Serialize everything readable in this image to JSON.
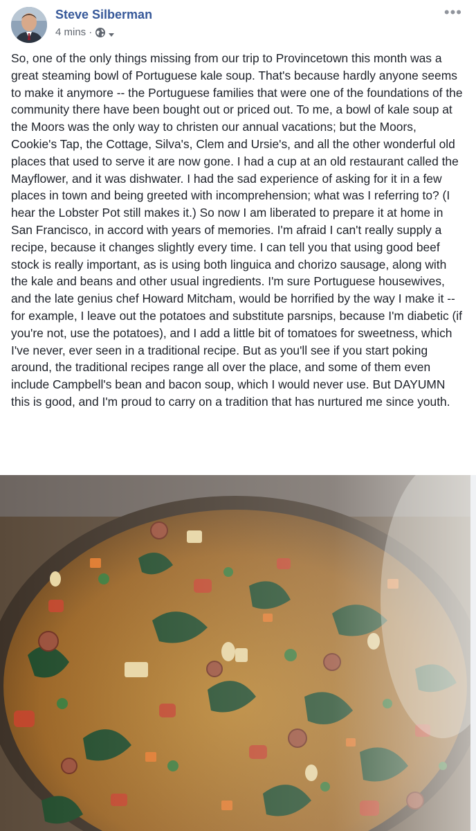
{
  "post": {
    "author": "Steve Silberman",
    "time": "4 mins",
    "privacy_icon": "globe-icon",
    "menu_icon": "more-options-icon",
    "more_label": "•••",
    "text": "So, one of the only things missing from our trip to Provincetown this month was a great steaming bowl of Portuguese kale soup. That's because hardly anyone seems to make it anymore -- the Portuguese families that were one of the foundations of the community there have been bought out or priced out. To me, a bowl of kale soup at the Moors was the only way to christen our annual vacations; but the Moors, Cookie's Tap, the Cottage, Silva's, Clem and Ursie's, and all the other wonderful old places that used to serve it are now gone. I had a cup at an old restaurant called the Mayflower, and it was dishwater. I had the sad experience of asking for it in a few places in town and being greeted with incomprehension; what was I referring to? (I hear the Lobster Pot still makes it.) So now I am liberated to prepare it at home in San Francisco, in accord with years of memories. I'm afraid I can't really supply a recipe, because it changes slightly every time. I can tell you that using good beef stock is really important, as is using both linguica and chorizo sausage, along with the kale and beans and other usual ingredients. I'm sure Portuguese housewives, and the late genius chef Howard Mitcham, would be horrified by the way I make it -- for example, I leave out the potatoes and substitute parsnips, because I'm diabetic (if you're not, use the potatoes), and I add a little bit of tomatoes for sweetness, which I've never, ever seen in a traditional recipe. But as you'll see if you start poking around, the traditional recipes range all over the place, and some of them even include Campbell's bean and bacon soup, which I would never use. But DAYUMN this is good, and I'm proud to carry on a tradition that has nurtured me since youth."
  },
  "colors": {
    "author_link": "#365899",
    "meta_text": "#616770",
    "body_text": "#1d2129",
    "soup_broth": "#a8742a",
    "kale": "#1f4a2a",
    "chorizo": "#c0452a"
  }
}
